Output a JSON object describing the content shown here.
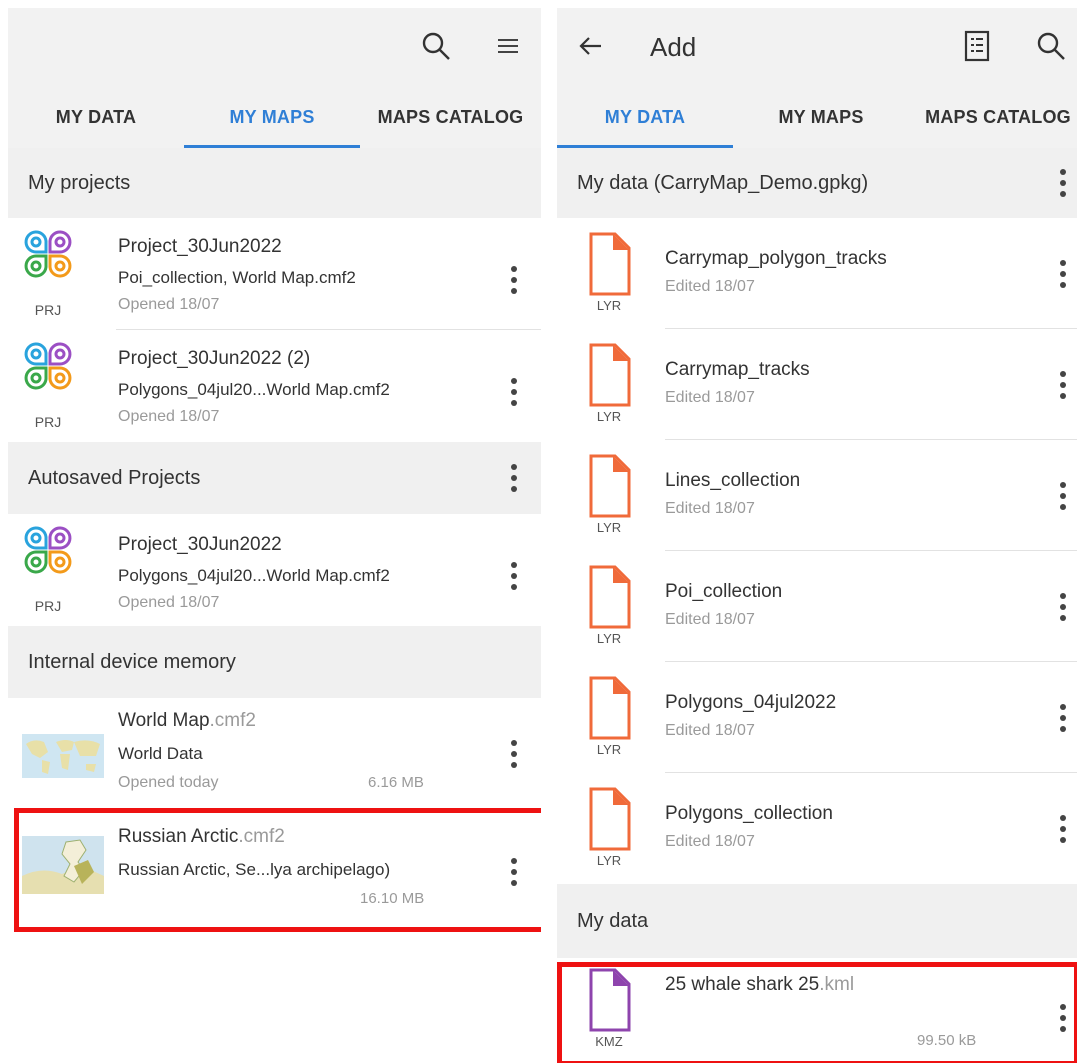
{
  "left": {
    "tabs": [
      "MY DATA",
      "MY MAPS",
      "MAPS CATALOG"
    ],
    "active_tab": "MY MAPS",
    "sections": {
      "my_projects": "My projects",
      "autosaved": "Autosaved Projects",
      "internal": "Internal device memory"
    },
    "projects": [
      {
        "name": "Project_30Jun2022",
        "files": "Poi_collection, World Map.cmf2",
        "opened": "Opened 18/07",
        "badge": "PRJ"
      },
      {
        "name": "Project_30Jun2022 (2)",
        "files": "Polygons_04jul20...World Map.cmf2",
        "opened": "Opened 18/07",
        "badge": "PRJ"
      }
    ],
    "autosaved": [
      {
        "name": "Project_30Jun2022",
        "files": "Polygons_04jul20...World Map.cmf2",
        "opened": "Opened 18/07",
        "badge": "PRJ"
      }
    ],
    "maps": [
      {
        "name": "World Map",
        "ext": ".cmf2",
        "desc": "World Data",
        "opened": "Opened today",
        "size": "6.16 MB"
      },
      {
        "name": "Russian Arctic",
        "ext": ".cmf2",
        "desc": "Russian Arctic, Se...lya archipelago)",
        "opened": "",
        "size": "16.10 MB"
      }
    ]
  },
  "right": {
    "title": "Add",
    "tabs": [
      "MY DATA",
      "MY MAPS",
      "MAPS CATALOG"
    ],
    "active_tab": "MY DATA",
    "section_gpkg": "My data (CarryMap_Demo.gpkg)",
    "layers": [
      {
        "name": "Carrymap_polygon_tracks",
        "edited": "Edited 18/07",
        "badge": "LYR"
      },
      {
        "name": "Carrymap_tracks",
        "edited": "Edited 18/07",
        "badge": "LYR"
      },
      {
        "name": "Lines_collection",
        "edited": "Edited 18/07",
        "badge": "LYR"
      },
      {
        "name": "Poi_collection",
        "edited": "Edited 18/07",
        "badge": "LYR"
      },
      {
        "name": "Polygons_04jul2022",
        "edited": "Edited 18/07",
        "badge": "LYR"
      },
      {
        "name": "Polygons_collection",
        "edited": "Edited 18/07",
        "badge": "LYR"
      }
    ],
    "section_mydata": "My data",
    "kml": {
      "name": "25 whale shark 25",
      "ext": ".kml",
      "size": "99.50 kB",
      "badge": "KMZ"
    }
  },
  "colors": {
    "accent": "#2f7fd6",
    "highlight": "#ee1111",
    "layer_icon": "#f06a3a",
    "kml_icon": "#8e44ad"
  },
  "icons": [
    "search-icon",
    "menu-icon",
    "back-arrow-icon",
    "layers-list-icon",
    "more-vert-icon",
    "project-icon",
    "layer-file-icon",
    "kml-file-icon",
    "map-thumbnail"
  ]
}
